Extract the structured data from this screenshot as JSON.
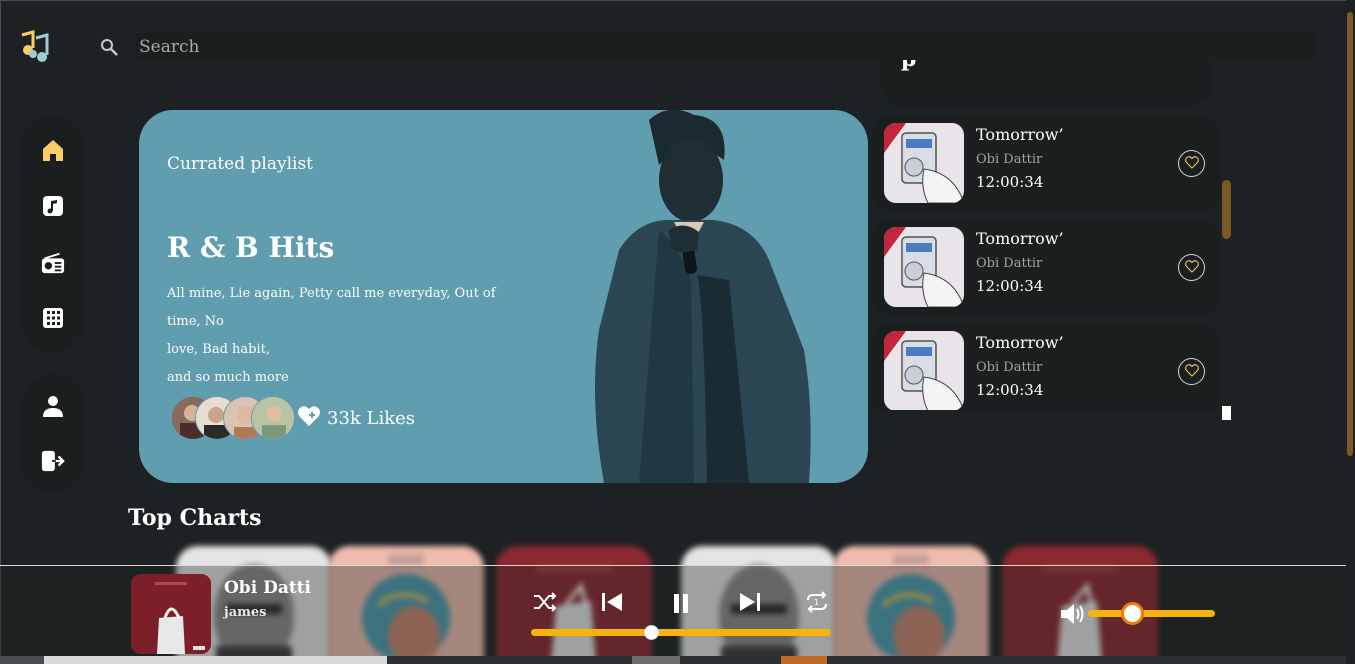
{
  "app": {
    "logo_icon": "music-notes-icon"
  },
  "search": {
    "placeholder": "Search",
    "icon": "search-icon"
  },
  "nav": {
    "primary": [
      {
        "name": "home",
        "icon": "home-icon",
        "active": true
      },
      {
        "name": "playlists",
        "icon": "music-note-icon",
        "active": false
      },
      {
        "name": "radio",
        "icon": "radio-icon",
        "active": false
      },
      {
        "name": "videos",
        "icon": "grid-icon",
        "active": false
      }
    ],
    "secondary": [
      {
        "name": "profile",
        "icon": "user-icon"
      },
      {
        "name": "logout",
        "icon": "logout-icon"
      }
    ]
  },
  "hero": {
    "kicker": "Currated playlist",
    "title": "R & B Hits",
    "description_lines": [
      "All mine, Lie again, Petty call me everyday, Out of time, No",
      "love, Bad habit,",
      "and so much more"
    ],
    "likes": "33k Likes",
    "likes_icon": "heart-plus-icon"
  },
  "top_in_charts": {
    "items": [
      {
        "title": "Tomorrow’",
        "artist": "Obi Dattir",
        "duration": "12:00:34"
      },
      {
        "title": "Tomorrow’",
        "artist": "Obi Dattir",
        "duration": "12:00:34"
      },
      {
        "title": "Tomorrow’",
        "artist": "Obi Dattir",
        "duration": "12:00:34"
      }
    ]
  },
  "top_charts": {
    "title": "Top Charts"
  },
  "player": {
    "title": "Obi Datti",
    "artist": "james",
    "progress": 0.4,
    "volume": 0.35,
    "controls": [
      "shuffle-icon",
      "previous-icon",
      "pause-icon",
      "next-icon",
      "repeat-one-icon"
    ]
  },
  "colors": {
    "background": "#1d2123",
    "panel": "#1a1e1f",
    "accent": "#facd66",
    "slider": "#f6b30c",
    "hero": "#609eaf"
  }
}
